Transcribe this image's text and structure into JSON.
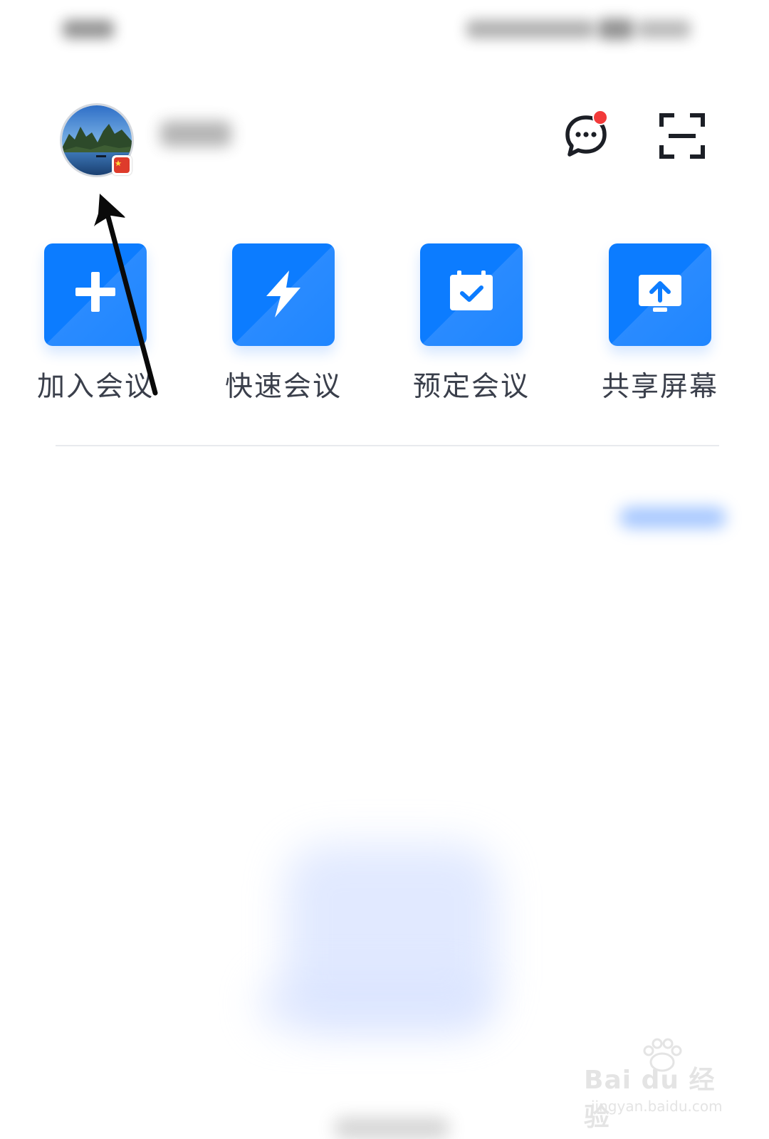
{
  "header": {
    "avatar": "avatar-landscape-photo",
    "chat_icon": "chat-bubble-icon",
    "scan_icon": "scan-icon",
    "notification_dot_color": "#f23a3a"
  },
  "actions": [
    {
      "label": "加入会议",
      "icon": "plus-icon"
    },
    {
      "label": "快速会议",
      "icon": "lightning-icon"
    },
    {
      "label": "预定会议",
      "icon": "calendar-check-icon"
    },
    {
      "label": "共享屏幕",
      "icon": "screen-share-icon"
    }
  ],
  "colors": {
    "accent": "#0c7cff",
    "label_text": "#3a3f4b",
    "divider": "#e8eaee"
  },
  "watermark": {
    "brand": "Bai du 经验",
    "url": "jingyan.baidu.com"
  }
}
